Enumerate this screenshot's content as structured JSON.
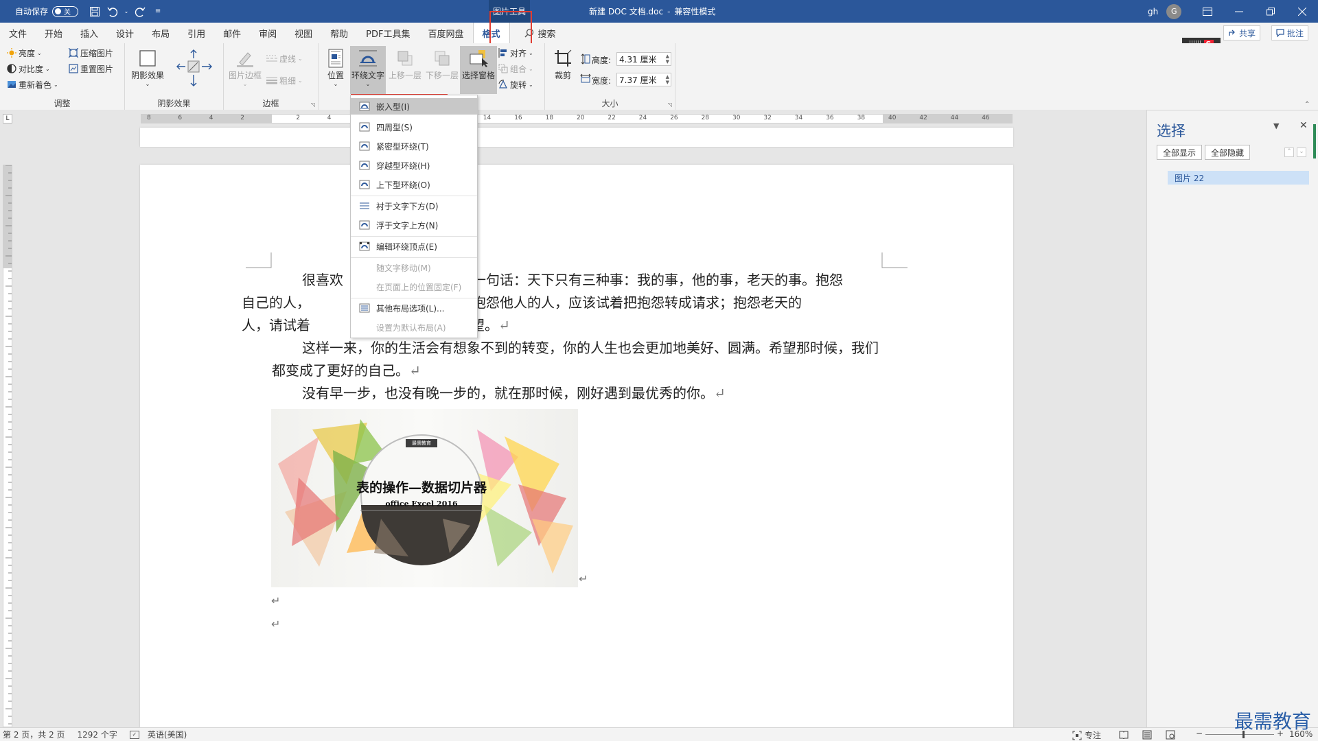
{
  "titlebar": {
    "autosave_label": "自动保存",
    "autosave_state": "关",
    "context_tab": "图片工具",
    "title": "新建 DOC 文档.doc",
    "separator": "-",
    "mode": "兼容性模式",
    "user": "gh",
    "avatar_letter": "G"
  },
  "menu": {
    "tabs": [
      "文件",
      "开始",
      "插入",
      "设计",
      "布局",
      "引用",
      "邮件",
      "审阅",
      "视图",
      "帮助",
      "PDF工具集",
      "百度网盘",
      "格式"
    ],
    "search": "搜索",
    "share": "共享",
    "comment": "批注"
  },
  "ribbon": {
    "adjust": {
      "brightness": "亮度",
      "contrast": "对比度",
      "recolor": "重新着色",
      "compress": "压缩图片",
      "reset": "重置图片",
      "label": "调整"
    },
    "shadow": {
      "btn": "阴影效果",
      "label": "阴影效果"
    },
    "border": {
      "frame": "图片边框",
      "dash": "虚线",
      "weight": "粗细",
      "label": "边框"
    },
    "arrange": {
      "position": "位置",
      "wrap": "环绕文字",
      "forward": "上移一层",
      "backward": "下移一层",
      "selpane": "选择窗格",
      "align": "对齐",
      "group": "组合",
      "rotate": "旋转"
    },
    "size": {
      "crop": "裁剪",
      "height_label": "高度:",
      "height_value": "4.31 厘米",
      "width_label": "宽度:",
      "width_value": "7.37 厘米",
      "label": "大小"
    }
  },
  "wrap_menu": {
    "items": [
      {
        "label": "嵌入型(I)",
        "disabled": false,
        "highlight": true
      },
      {
        "label": "四周型(S)",
        "disabled": false
      },
      {
        "label": "紧密型环绕(T)",
        "disabled": false
      },
      {
        "label": "穿越型环绕(H)",
        "disabled": false
      },
      {
        "label": "上下型环绕(O)",
        "disabled": false
      },
      {
        "label": "衬于文字下方(D)",
        "disabled": false
      },
      {
        "label": "浮于文字上方(N)",
        "disabled": false
      },
      {
        "label": "编辑环绕顶点(E)",
        "disabled": false
      },
      {
        "label": "随文字移动(M)",
        "disabled": true
      },
      {
        "label": "在页面上的位置固定(F)",
        "disabled": true
      },
      {
        "label": "其他布局选项(L)...",
        "disabled": false
      },
      {
        "label": "设置为默认布局(A)",
        "disabled": true
      }
    ]
  },
  "ruler": {
    "labels": [
      "8",
      "6",
      "4",
      "2",
      "2",
      "4",
      "6",
      "8",
      "10",
      "12",
      "14",
      "16",
      "18",
      "20",
      "22",
      "24",
      "26",
      "28",
      "30",
      "32",
      "34",
      "36",
      "38",
      "40",
      "42",
      "44",
      "46",
      "48"
    ]
  },
  "document": {
    "p1_a": "很喜欢",
    "p1_b": "一句话：天下只有三种事：我的事，他的事，老天的事。抱怨",
    "p1_c": "自己的人，",
    "p1_d": "自己；抱怨他人的人，应该试着把抱怨转成请求；抱怨老天的",
    "p1_e": "人，请试着",
    "p1_f": "求你的愿望。",
    "p2": "这样一来，你的生活会有想象不到的转变，你的人生也会更加地美好、圆满。希望那时候，我们都变成了更好的自己。",
    "p3": "没有早一步，也没有晚一步的，就在那时候，刚好遇到最优秀的你。",
    "mark": "↵",
    "image": {
      "badge": "最需教育",
      "title": "表的操作—数据切片器",
      "subtitle": "office Excel 2016"
    }
  },
  "pane": {
    "title": "选择",
    "show_all": "全部显示",
    "hide_all": "全部隐藏",
    "item": "图片 22"
  },
  "status": {
    "page": "第 2 页，共 2 页",
    "words": "1292 个字",
    "lang": "英语(美国)",
    "focus": "专注",
    "zoom": "160%"
  },
  "watermark": "最需教育",
  "colors": {
    "titlebar": "#2b579a",
    "highlight": "#e03c31",
    "selection": "#cde1f7"
  }
}
